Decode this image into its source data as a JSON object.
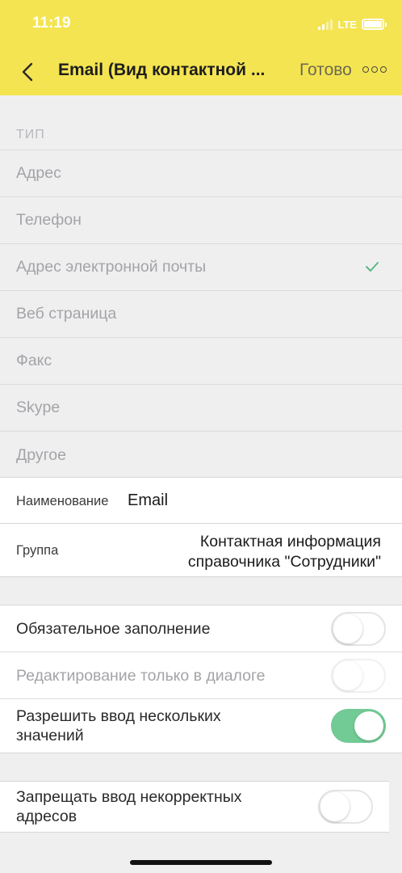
{
  "status_bar": {
    "time": "11:19",
    "network": "LTE"
  },
  "nav": {
    "back_icon": "chevron-left-icon",
    "title": "Email (Вид контактной ...",
    "done_label": "Готово",
    "more_icon": "more-dots-icon"
  },
  "type_section": {
    "caption": "ТИП",
    "items": [
      {
        "label": "Адрес",
        "selected": false
      },
      {
        "label": "Телефон",
        "selected": false
      },
      {
        "label": "Адрес электронной почты",
        "selected": true
      },
      {
        "label": "Веб страница",
        "selected": false
      },
      {
        "label": "Факс",
        "selected": false
      },
      {
        "label": "Skype",
        "selected": false
      },
      {
        "label": "Другое",
        "selected": false
      }
    ],
    "check_color": "#5cb785"
  },
  "fields": {
    "name_label": "Наименование",
    "name_value": "Email",
    "group_label": "Группа",
    "group_value_line1": "Контактная информация",
    "group_value_line2": "справочника \"Сотрудники\""
  },
  "toggles": {
    "required": {
      "label": "Обязательное заполнение",
      "on": false
    },
    "dialog_only": {
      "label": "Редактирование только в диалоге",
      "on": false,
      "disabled": true
    },
    "multiple": {
      "line1": "Разрешить ввод нескольких",
      "line2": "значений",
      "on": true
    },
    "forbid_invalid": {
      "line1": "Запрещать ввод некорректных",
      "line2": "адресов",
      "on": false
    }
  },
  "colors": {
    "header": "#f4e451",
    "switch_on": "#72ca95"
  }
}
